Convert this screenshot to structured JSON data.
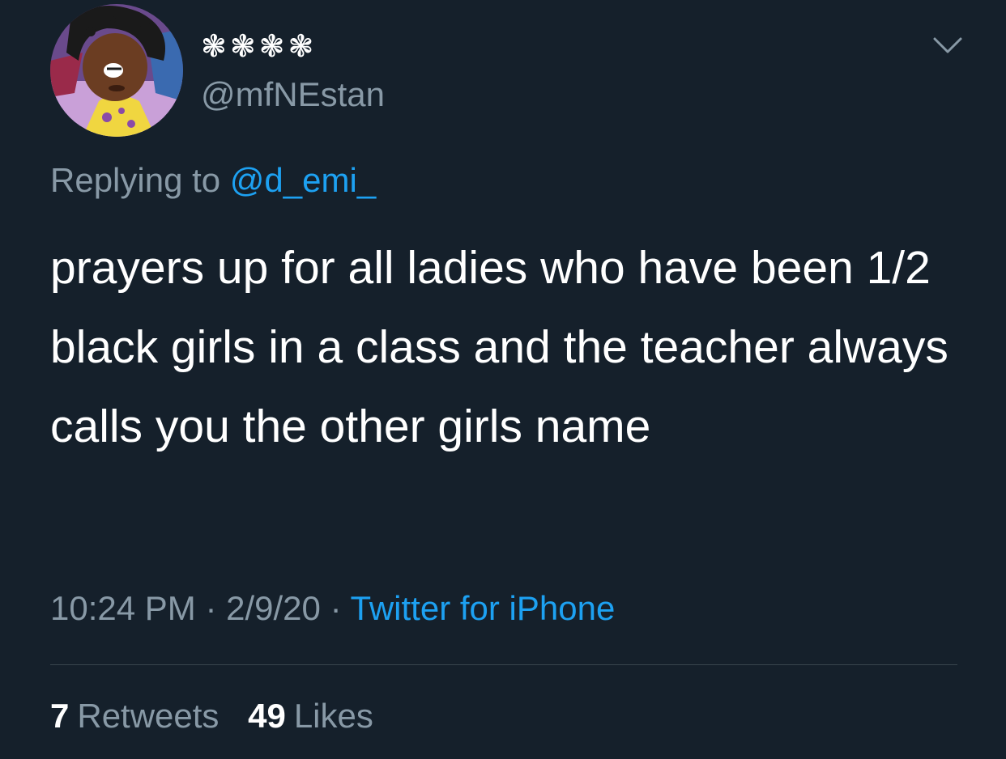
{
  "user": {
    "display_name": "❃❃❃❃",
    "handle": "@mfNEstan"
  },
  "reply": {
    "prefix": "Replying to",
    "mention": "@d_emi_"
  },
  "tweet": {
    "text": "prayers up for all ladies who have been 1/2 black girls in a class and the teacher always calls you the other girls name"
  },
  "meta": {
    "time": "10:24 PM",
    "separator_1": "·",
    "date": "2/9/20",
    "separator_2": "·",
    "source": "Twitter for iPhone"
  },
  "stats": {
    "retweets_count": "7",
    "retweets_label": "Retweets",
    "likes_count": "49",
    "likes_label": "Likes"
  },
  "icons": {
    "menu": "chevron-down-icon",
    "avatar": "avatar"
  },
  "colors": {
    "background": "#15202b",
    "primary_text": "#ffffff",
    "secondary_text": "#8899a6",
    "accent": "#1da1f2",
    "divider": "#38444d"
  }
}
